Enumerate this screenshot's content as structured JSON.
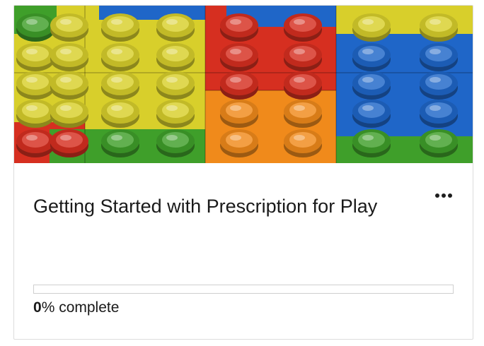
{
  "course": {
    "title": "Getting Started with Prescription for Play",
    "image_alt": "colorful toy building bricks",
    "progress_percent": "0",
    "progress_suffix": "% complete",
    "menu_icon": "more-horizontal-icon"
  },
  "colors": {
    "green": "#3f9f2a",
    "yellow": "#d8cf2b",
    "red": "#d62f20",
    "orange": "#f08a1b",
    "blue": "#1f66c8",
    "progress_fill": "#2f6fbf"
  }
}
